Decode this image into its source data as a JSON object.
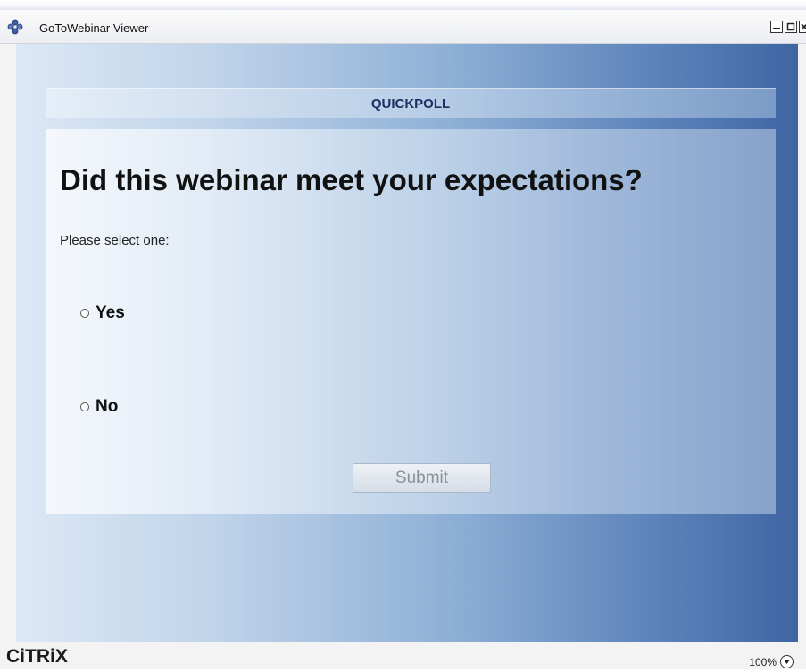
{
  "window": {
    "title": "GoToWebinar Viewer"
  },
  "poll": {
    "header": "QUICKPOLL",
    "question": "Did this webinar meet your expectations?",
    "instruction": "Please select one:",
    "options": [
      {
        "label": "Yes",
        "selected": false
      },
      {
        "label": "No",
        "selected": false
      }
    ],
    "submit_label": "Submit"
  },
  "footer": {
    "brand": "CiTRiX",
    "zoom_level": "100%"
  },
  "colors": {
    "header_text": "#1d2f63",
    "canvas_dark": "#3f66a3",
    "canvas_light": "#dce8f6"
  },
  "icons": {
    "app": "gotowebinar-flower-icon",
    "minimize": "minimize-icon",
    "maximize": "maximize-icon",
    "close": "close-icon",
    "zoom": "chevron-down-icon"
  }
}
